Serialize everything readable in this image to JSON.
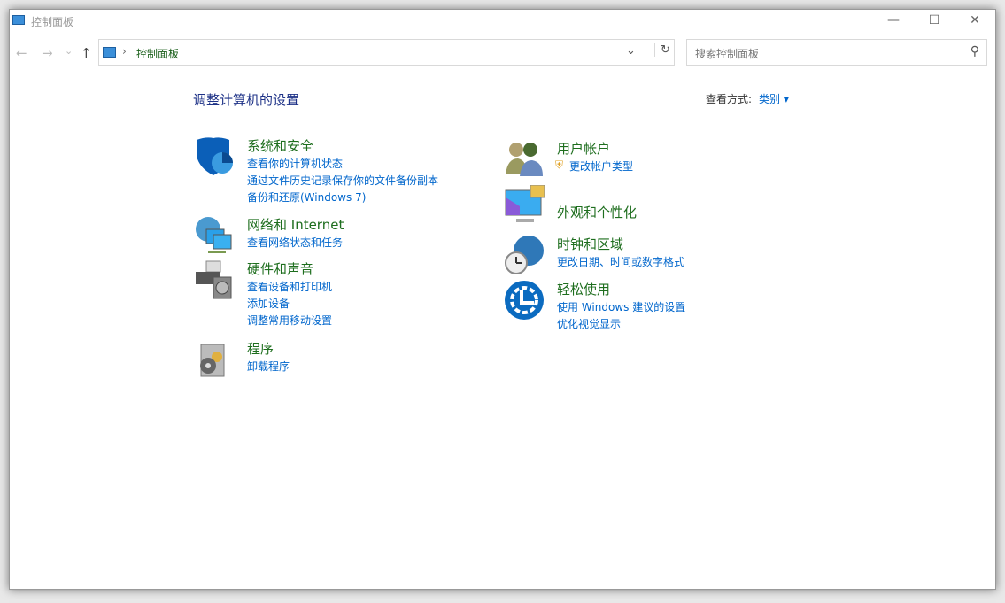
{
  "window": {
    "title": "控制面板",
    "minimize": "—",
    "maximize": "☐",
    "close": "✕"
  },
  "nav": {
    "back": "←",
    "forward": "→",
    "recent": "⌄",
    "up": "↑"
  },
  "address": {
    "separator": "›",
    "crumb": "控制面板",
    "dropdown": "⌄",
    "refresh": "↻"
  },
  "search": {
    "placeholder": "搜索控制面板",
    "icon": "⚲"
  },
  "heading": "调整计算机的设置",
  "view": {
    "label": "查看方式:",
    "value": "类别 ▾"
  },
  "left": [
    {
      "title": "系统和安全",
      "links": [
        "查看你的计算机状态",
        "通过文件历史记录保存你的文件备份副本",
        "备份和还原(Windows 7)"
      ]
    },
    {
      "title": "网络和 Internet",
      "links": [
        "查看网络状态和任务"
      ]
    },
    {
      "title": "硬件和声音",
      "links": [
        "查看设备和打印机",
        "添加设备",
        "调整常用移动设置"
      ]
    },
    {
      "title": "程序",
      "links": [
        "卸载程序"
      ]
    }
  ],
  "right": [
    {
      "title": "用户帐户",
      "links": [
        "更改帐户类型"
      ]
    },
    {
      "title": "外观和个性化",
      "links": []
    },
    {
      "title": "时钟和区域",
      "links": [
        "更改日期、时间或数字格式"
      ]
    },
    {
      "title": "轻松使用",
      "links": [
        "使用 Windows 建议的设置",
        "优化视觉显示"
      ]
    }
  ]
}
